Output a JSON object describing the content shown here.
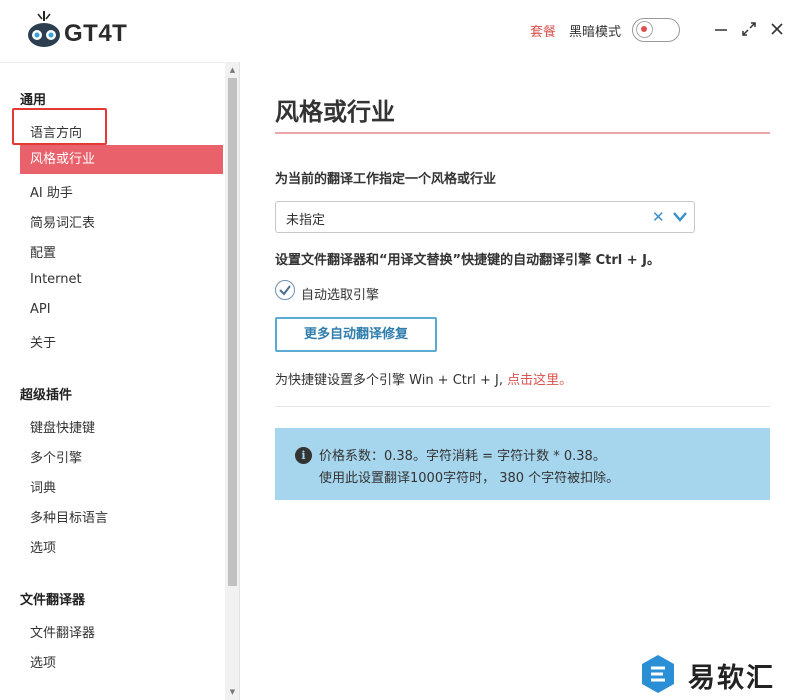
{
  "app": {
    "logo_text": "GT4T"
  },
  "header": {
    "package_link": "套餐",
    "dark_mode_label": "黑暗模式",
    "dark_mode_on": false
  },
  "sidebar": {
    "groups": [
      {
        "title": "通用",
        "items": [
          "语言方向",
          "风格或行业",
          "AI 助手",
          "简易词汇表",
          "配置",
          "Internet",
          "API",
          "关于"
        ]
      },
      {
        "title": "超级插件",
        "items": [
          "键盘快捷键",
          "多个引擎",
          "词典",
          "多种目标语言",
          "选项"
        ]
      },
      {
        "title": "文件翻译器",
        "items": [
          "文件翻译器",
          "选项"
        ]
      }
    ],
    "active_item": "风格或行业"
  },
  "main": {
    "page_title": "风格或行业",
    "style_label": "为当前的翻译工作指定一个风格或行业",
    "style_select_value": "未指定",
    "shortcut_label": "设置文件翻译器和“用译文替换”快捷键的自动翻译引擎 Ctrl + J。",
    "auto_select_label": "自动选取引擎",
    "auto_select_checked": true,
    "more_button": "更多自动翻译修复",
    "multi_engine_text": "为快捷键设置多个引擎 Win + Ctrl + J, ",
    "multi_engine_link": "点击这里。",
    "info_line1": "价格系数：0.38。字符消耗 = 字符计数 * 0.38。",
    "info_line2": "使用此设置翻译1000字符时， 380 个字符被扣除。"
  },
  "watermark": {
    "text": "易软汇"
  },
  "colors": {
    "accent": "#e9616a",
    "info_bg": "#a6d6ee",
    "link": "#d9534f",
    "button_border": "#5aaad3"
  }
}
